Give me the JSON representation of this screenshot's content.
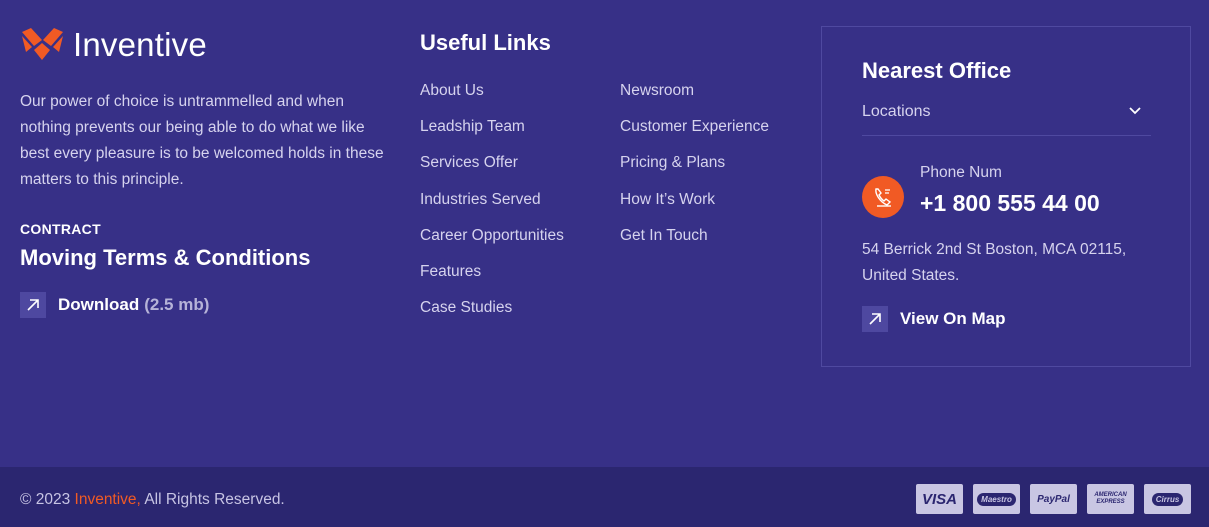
{
  "brand": {
    "name": "Inventive",
    "accent": "#f15a24"
  },
  "about": {
    "text": "Our power of choice is untrammelled and when nothing prevents our being able to do what we like best every pleasure is to be welcomed holds in these matters to this principle."
  },
  "contract": {
    "label": "CONTRACT",
    "title": "Moving Terms & Conditions",
    "download_label": "Download",
    "download_size": "(2.5 mb)"
  },
  "links": {
    "title": "Useful Links",
    "col_a": [
      "About Us",
      "Leadship Team",
      "Services Offer",
      "Industries Served",
      "Career Opportunities",
      "Features",
      "Case Studies"
    ],
    "col_b": [
      "Newsroom",
      "Customer Experience",
      "Pricing & Plans",
      "How It’s Work",
      "Get In Touch"
    ]
  },
  "office": {
    "title": "Nearest Office",
    "select_value": "Locations",
    "phone_label": "Phone Num",
    "phone_number": "+1 800 555 44 00",
    "address": "54 Berrick 2nd St Boston, MCA 02115, United States.",
    "view_map_label": "View On Map"
  },
  "footer": {
    "copyright_prefix": "© 2023 ",
    "copyright_brand": "Inventive,",
    "copyright_suffix": " All Rights Reserved.",
    "cards": [
      "VISA",
      "Maestro",
      "PayPal",
      "AMERICAN EXPRESS",
      "Cirrus"
    ]
  },
  "colors": {
    "background": "#373087",
    "bottom_bar": "#2b2670",
    "accent": "#f15a24"
  }
}
